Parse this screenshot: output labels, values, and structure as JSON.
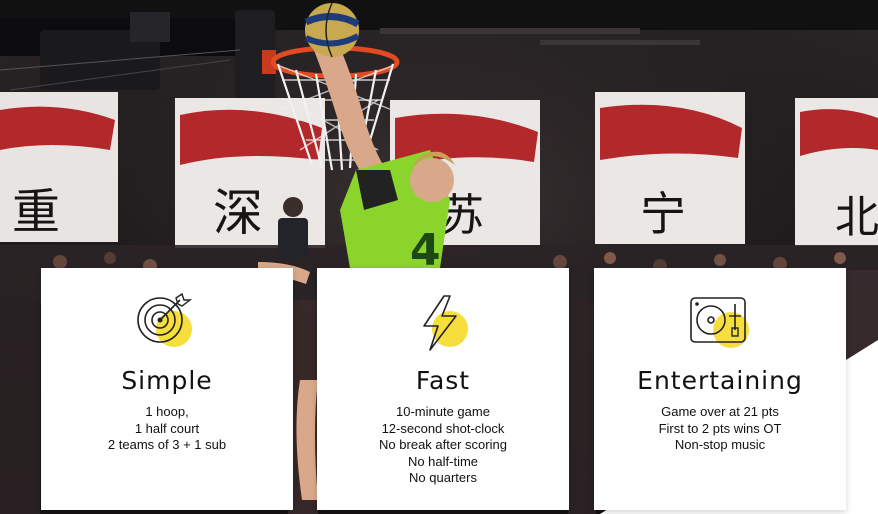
{
  "colors": {
    "accent": "#f6de3c",
    "text": "#111111",
    "card_bg": "#ffffff"
  },
  "background": {
    "banner_marks": [
      "重",
      "深",
      "苏",
      "宁",
      "北"
    ],
    "jersey_number": "4"
  },
  "cards": [
    {
      "icon": "target-icon",
      "title": "Simple",
      "lines": [
        "1 hoop,",
        "1 half court",
        "2 teams of 3 + 1 sub"
      ]
    },
    {
      "icon": "lightning-icon",
      "title": "Fast",
      "lines": [
        "10-minute game",
        "12-second shot-clock",
        "No break after scoring",
        "No half-time",
        "No quarters"
      ]
    },
    {
      "icon": "turntable-icon",
      "title": "Entertaining",
      "lines": [
        "Game over at 21 pts",
        "First to 2 pts wins OT",
        "Non-stop music"
      ]
    }
  ]
}
